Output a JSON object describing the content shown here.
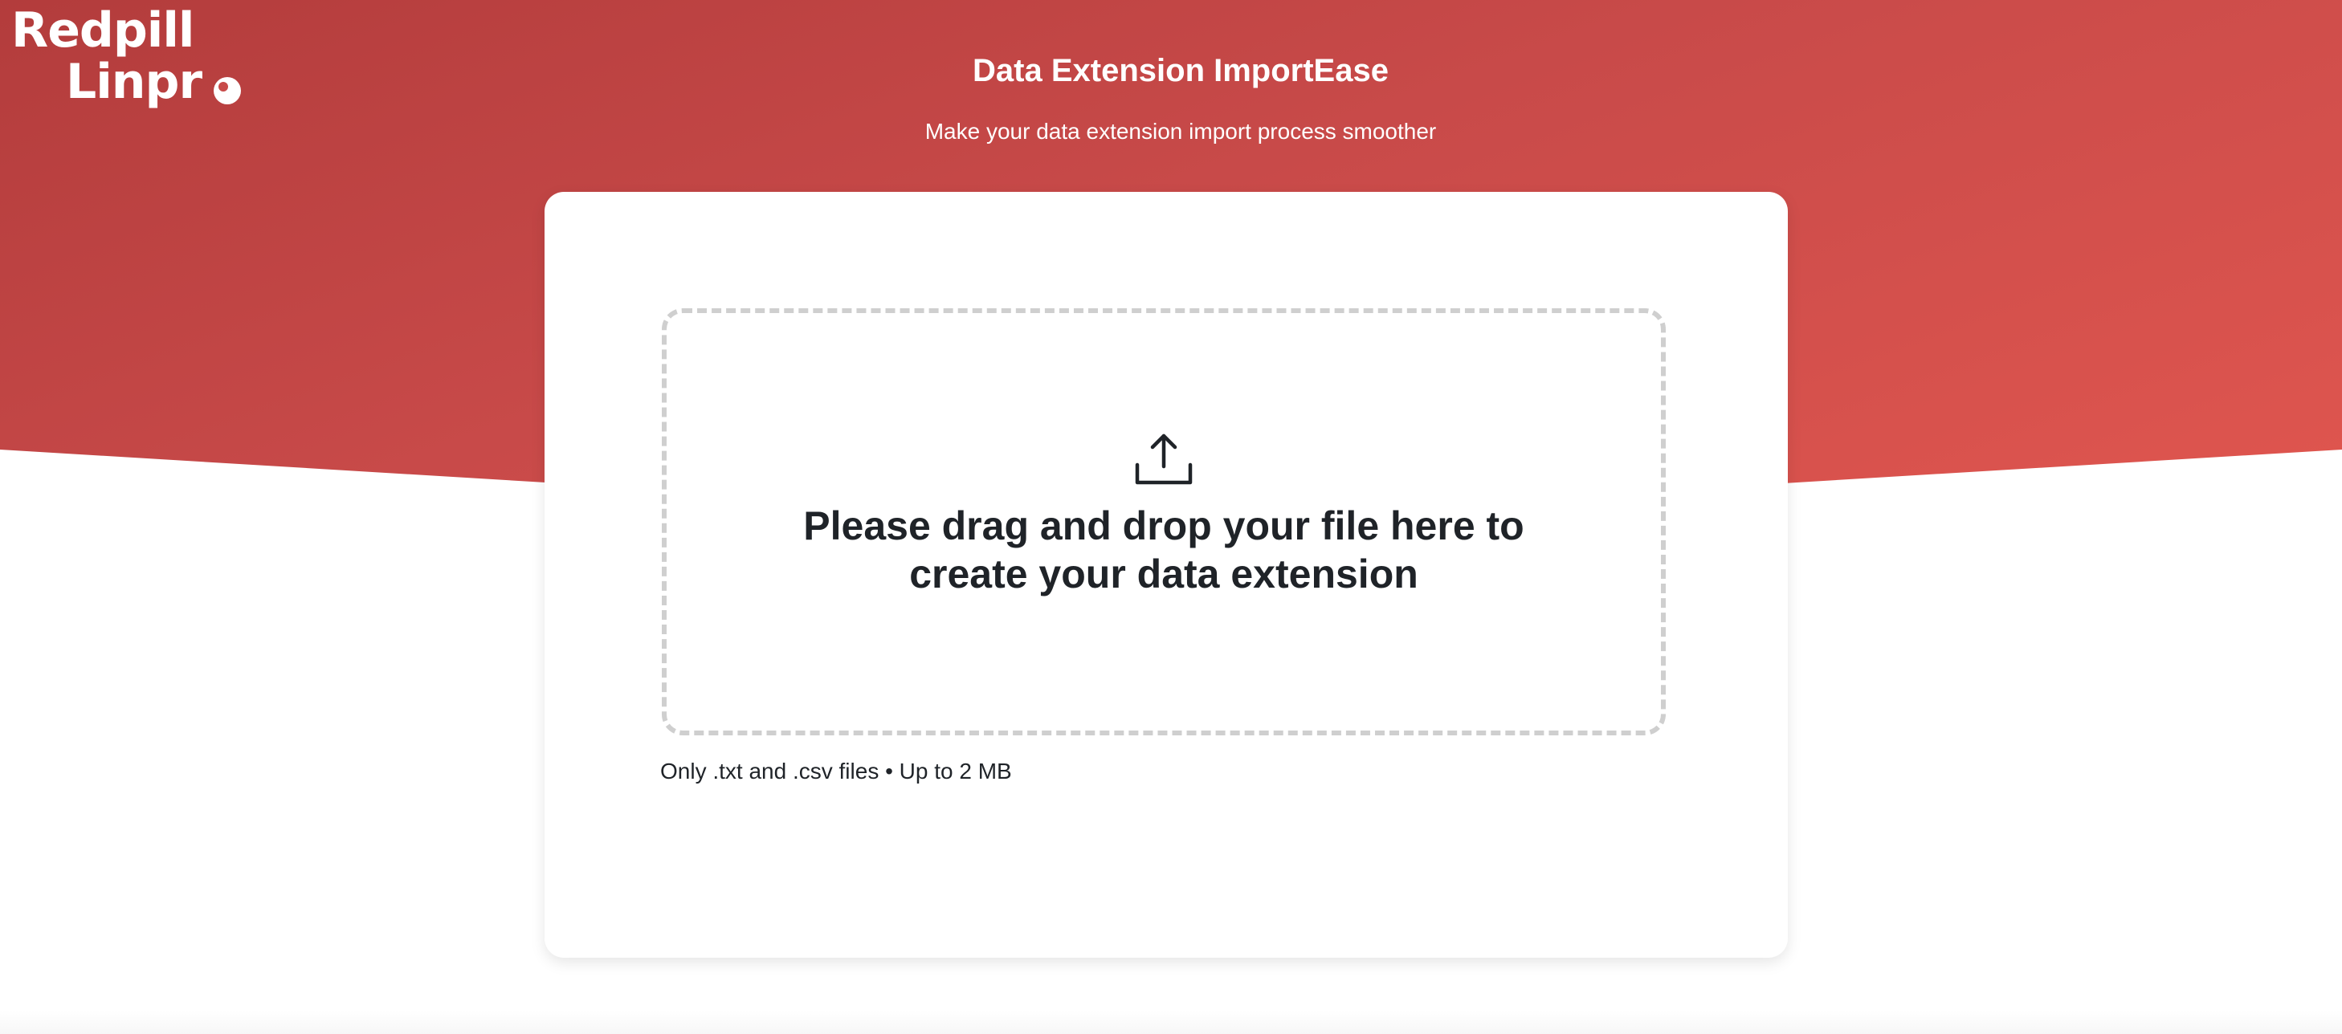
{
  "brand": {
    "logo_line_1": "Redpill",
    "logo_line_2": "Linpr",
    "accent_color": "#c84a49"
  },
  "header": {
    "title": "Data Extension ImportEase",
    "subtitle": "Make your data extension import process smoother"
  },
  "upload": {
    "icon": "upload-icon",
    "prompt": "Please drag and drop your file here to create your data extension",
    "hint": "Only .txt and .csv files • Up to 2 MB"
  }
}
